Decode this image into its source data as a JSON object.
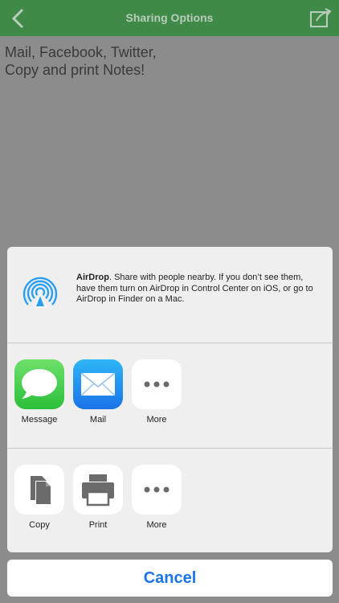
{
  "navbar": {
    "title": "Sharing Options"
  },
  "note": {
    "text": "Mail, Facebook, Twitter,\nCopy and print Notes!"
  },
  "airdrop": {
    "title": "AirDrop",
    "description": ". Share with people nearby. If you don’t see them, have them turn on AirDrop in Control Center on iOS, or go to AirDrop in Finder on a Mac."
  },
  "apps": [
    {
      "label": "Message",
      "icon": "message-icon"
    },
    {
      "label": "Mail",
      "icon": "mail-icon"
    },
    {
      "label": "More",
      "icon": "more-icon"
    }
  ],
  "actions": [
    {
      "label": "Copy",
      "icon": "copy-icon"
    },
    {
      "label": "Print",
      "icon": "print-icon"
    },
    {
      "label": "More",
      "icon": "more-icon"
    }
  ],
  "cancel": {
    "label": "Cancel"
  },
  "colors": {
    "navbar": "#3f8a48",
    "accent": "#1d73e8",
    "airdrop": "#2a9ff0"
  }
}
